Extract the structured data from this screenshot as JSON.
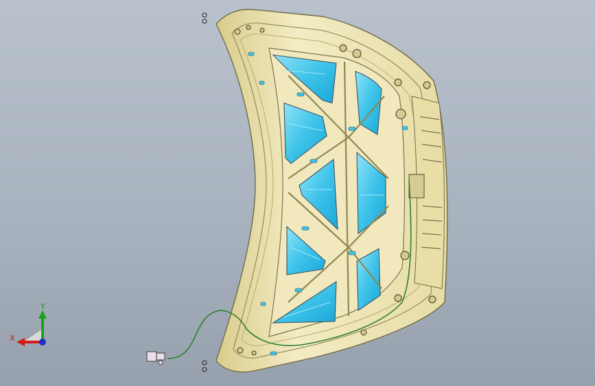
{
  "viewport": {
    "background_top": "#b8c1cc",
    "background_bottom": "#97a1ae"
  },
  "model": {
    "part_icon": "car-hood-inner-panel-icon",
    "panel_color": "#efe6b4",
    "panel_edge_color": "#6e6a45",
    "window_color": "#3fc4ea",
    "window_highlight": "#8fe3f7",
    "cable_color": "#2f7d2f"
  },
  "triad": {
    "x_label": "X",
    "y_label": "Y",
    "x_color": "#d21b1b",
    "y_color": "#19a31b",
    "z_color": "#1e2fd0"
  }
}
